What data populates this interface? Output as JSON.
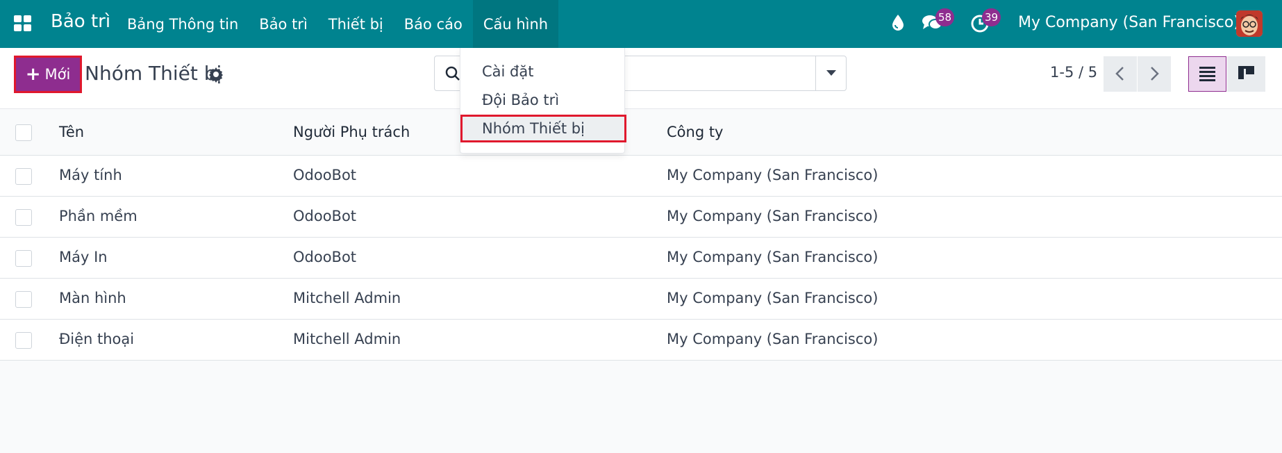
{
  "navbar": {
    "app_name": "Bảo trì",
    "menu": [
      "Bảng Thông tin",
      "Bảo trì",
      "Thiết bị",
      "Báo cáo",
      "Cấu hình"
    ],
    "active_menu": "Cấu hình",
    "messages_count": "58",
    "activities_count": "39",
    "company": "My Company (San Francisco)",
    "icons": [
      "apps-icon",
      "drop-icon",
      "chat-icon",
      "clock-icon",
      "avatar"
    ],
    "accent_color": "#00838f"
  },
  "control": {
    "new_label": "Mới",
    "title": "Nhóm Thiết bị",
    "search_placeholder": "",
    "pager": "1-5 / 5",
    "primary_color": "#8e2d8f"
  },
  "dropdown": {
    "items": [
      "Cài đặt",
      "Đội Bảo trì",
      "Nhóm Thiết bị"
    ],
    "selected": "Nhóm Thiết bị"
  },
  "table": {
    "headers": [
      "Tên",
      "Người Phụ trách",
      "Công ty"
    ],
    "rows": [
      [
        "Máy tính",
        "OdooBot",
        "My Company (San Francisco)"
      ],
      [
        "Phần mềm",
        "OdooBot",
        "My Company (San Francisco)"
      ],
      [
        "Máy In",
        "OdooBot",
        "My Company (San Francisco)"
      ],
      [
        "Màn hình",
        "Mitchell Admin",
        "My Company (San Francisco)"
      ],
      [
        "Điện thoại",
        "Mitchell Admin",
        "My Company (San Francisco)"
      ]
    ]
  }
}
